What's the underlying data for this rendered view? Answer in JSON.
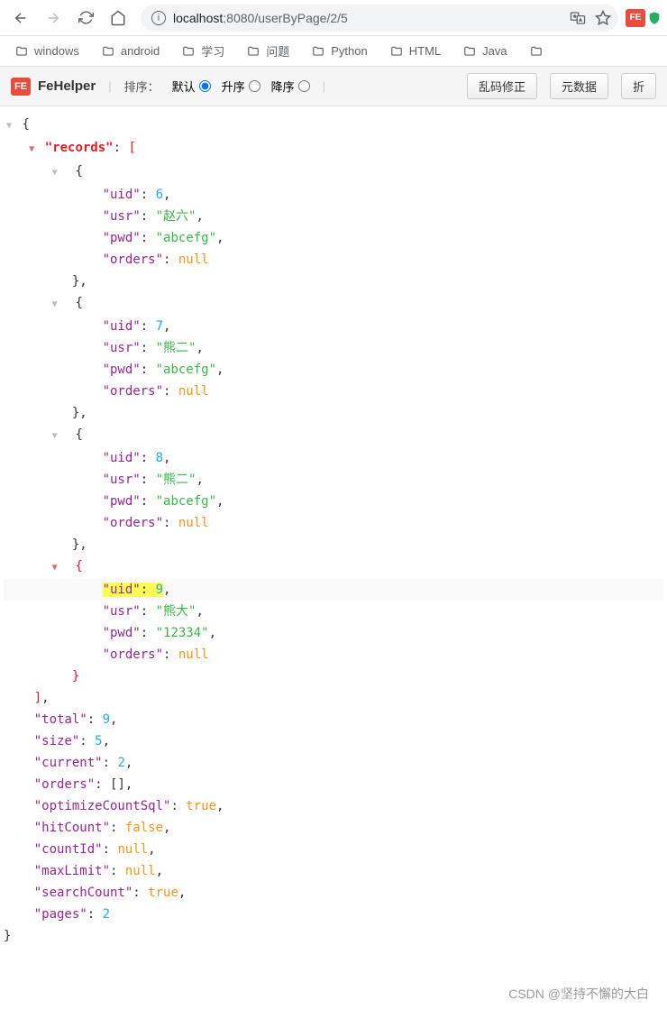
{
  "nav": {
    "url_host": "localhost",
    "url_port": ":8080",
    "url_path": "/userByPage/2/5",
    "ext_label": "FE"
  },
  "bookmarks": [
    {
      "label": "windows"
    },
    {
      "label": "android"
    },
    {
      "label": "学习"
    },
    {
      "label": "问题"
    },
    {
      "label": "Python"
    },
    {
      "label": "HTML"
    },
    {
      "label": "Java"
    }
  ],
  "toolbar": {
    "app": "FeHelper",
    "sort_label": "排序：",
    "opt_default": "默认",
    "opt_asc": "升序",
    "opt_desc": "降序",
    "btn_garbled": "乱码修正",
    "btn_meta": "元数据",
    "btn_fold": "折"
  },
  "json": {
    "records_key": "\"records\"",
    "records": [
      {
        "uid": 6,
        "usr": "赵六",
        "pwd": "abcefg",
        "orders": null
      },
      {
        "uid": 7,
        "usr": "熊二",
        "pwd": "abcefg",
        "orders": null
      },
      {
        "uid": 8,
        "usr": "熊二",
        "pwd": "abcefg",
        "orders": null
      },
      {
        "uid": 9,
        "usr": "熊大",
        "pwd": "12334",
        "orders": null
      }
    ],
    "total": 9,
    "size": 5,
    "current": 2,
    "orders": [],
    "optimizeCountSql": true,
    "hitCount": false,
    "countId": null,
    "maxLimit": null,
    "searchCount": true,
    "pages": 2
  },
  "watermark": "CSDN @坚持不懈的大白"
}
